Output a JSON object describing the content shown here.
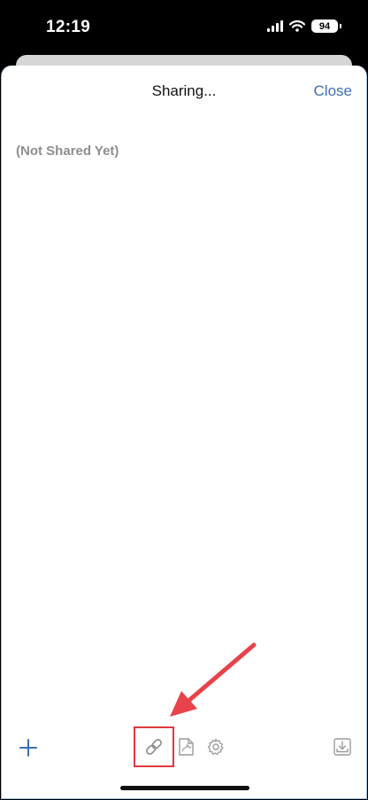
{
  "status_bar": {
    "time": "12:19",
    "battery": "94"
  },
  "sheet": {
    "title": "Sharing...",
    "close_label": "Close"
  },
  "content": {
    "empty_state": "(Not Shared Yet)"
  },
  "toolbar": {
    "add_icon": "plus-icon",
    "link_icon": "link-icon",
    "pdf_icon": "pdf-export-icon",
    "settings_icon": "gear-icon",
    "export_icon": "download-tray-icon"
  },
  "colors": {
    "accent": "#3a6fb3",
    "highlight": "#e0393f",
    "muted": "#8e8e8e"
  }
}
